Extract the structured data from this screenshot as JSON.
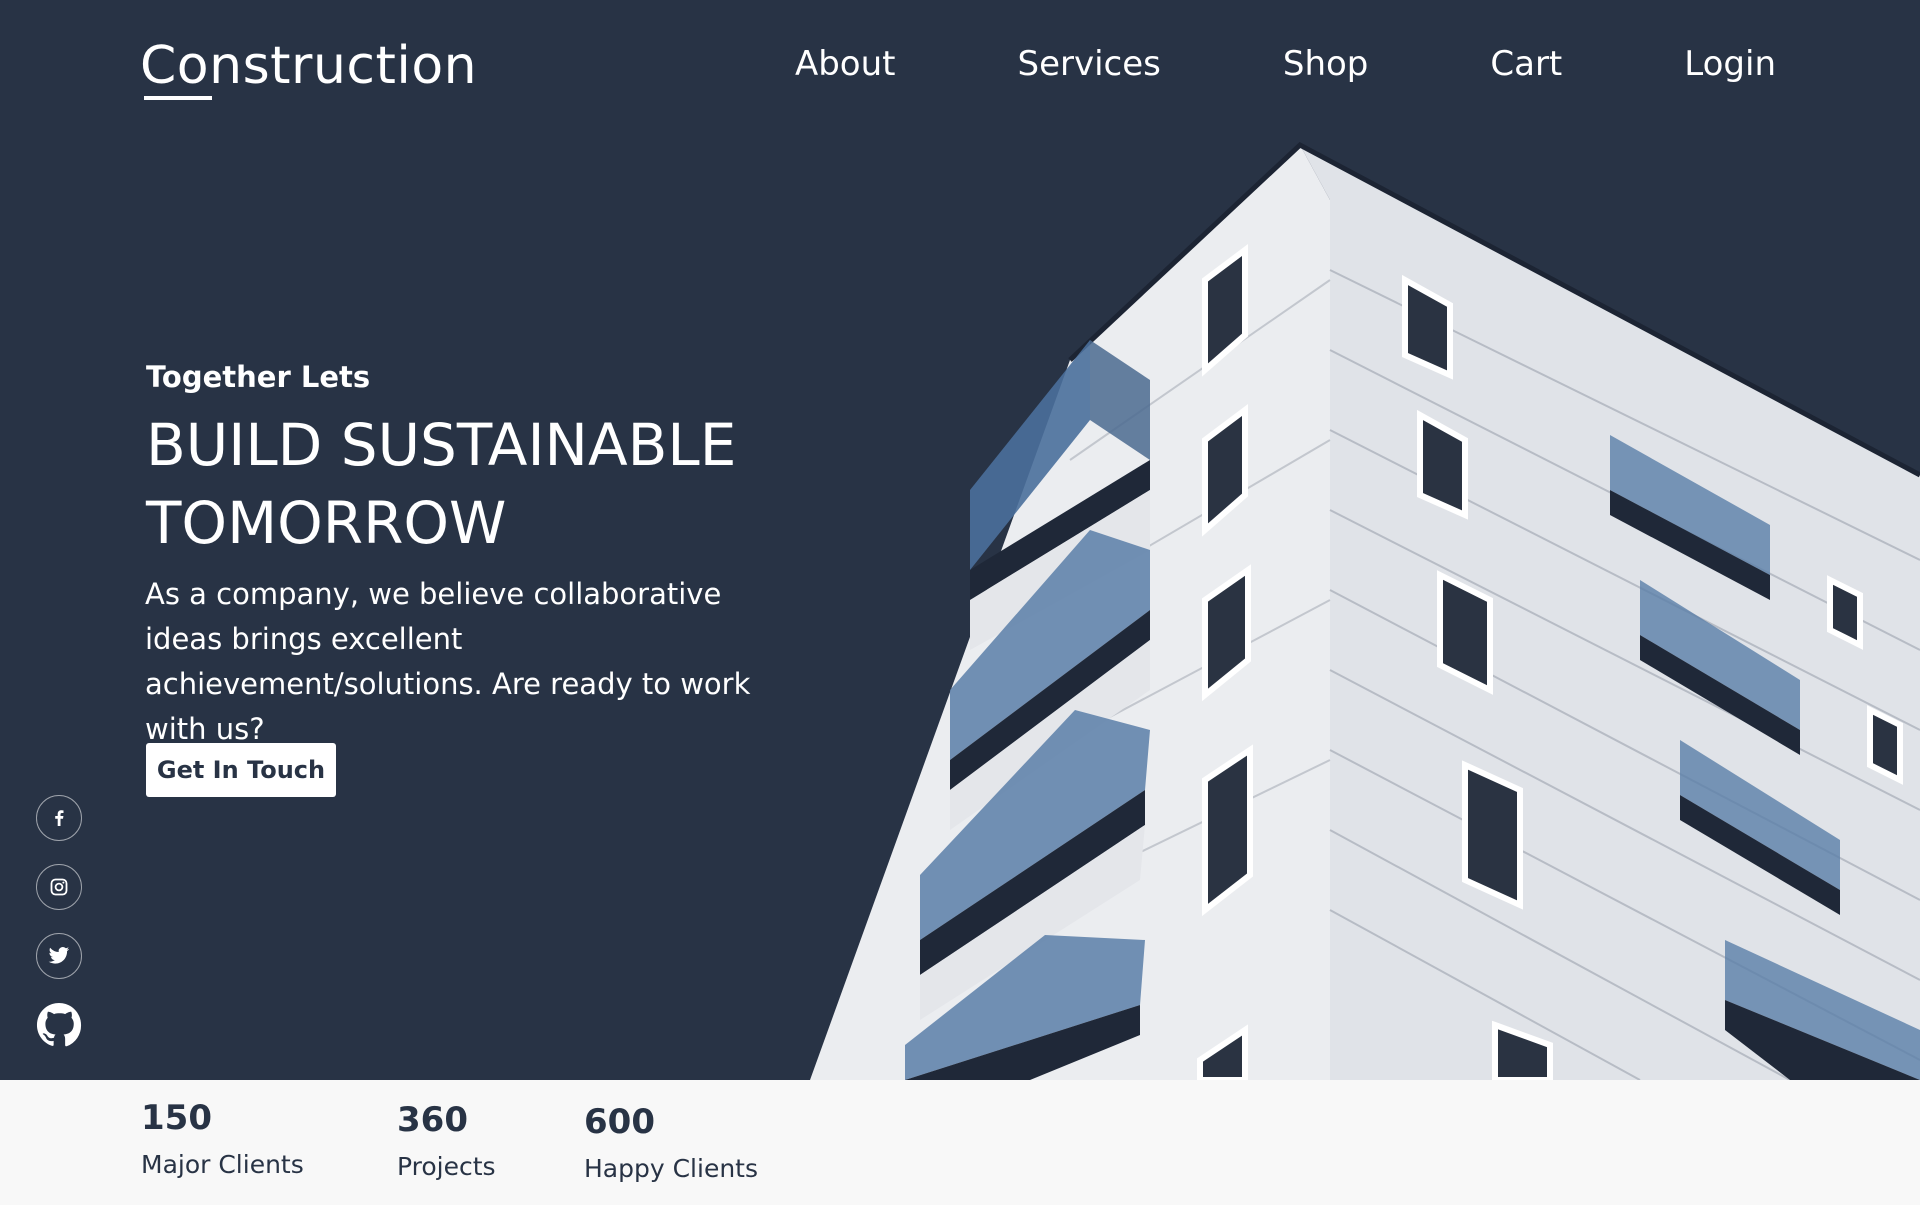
{
  "nav": {
    "logo": "Construction",
    "links": [
      "About",
      "Services",
      "Shop",
      "Cart",
      "Login"
    ]
  },
  "hero": {
    "eyebrow": "Together Lets",
    "headline_line1": "BUILD SUSTAINABLE",
    "headline_line2": "TOMORROW",
    "lead": "As a company, we believe collaborative  ideas brings excellent achievement/solutions. Are ready to work with us?",
    "cta": "Get In Touch"
  },
  "social": [
    "facebook-icon",
    "instagram-icon",
    "twitter-icon",
    "github-icon"
  ],
  "stats": [
    {
      "value": "150",
      "label": "Major Clients"
    },
    {
      "value": "360",
      "label": "Projects"
    },
    {
      "value": "600",
      "label": "Happy Clients"
    }
  ],
  "colors": {
    "hero_bg": "#283345",
    "footer_bg": "#f8f8f8",
    "text_light": "#ffffff",
    "text_dark": "#283345"
  }
}
